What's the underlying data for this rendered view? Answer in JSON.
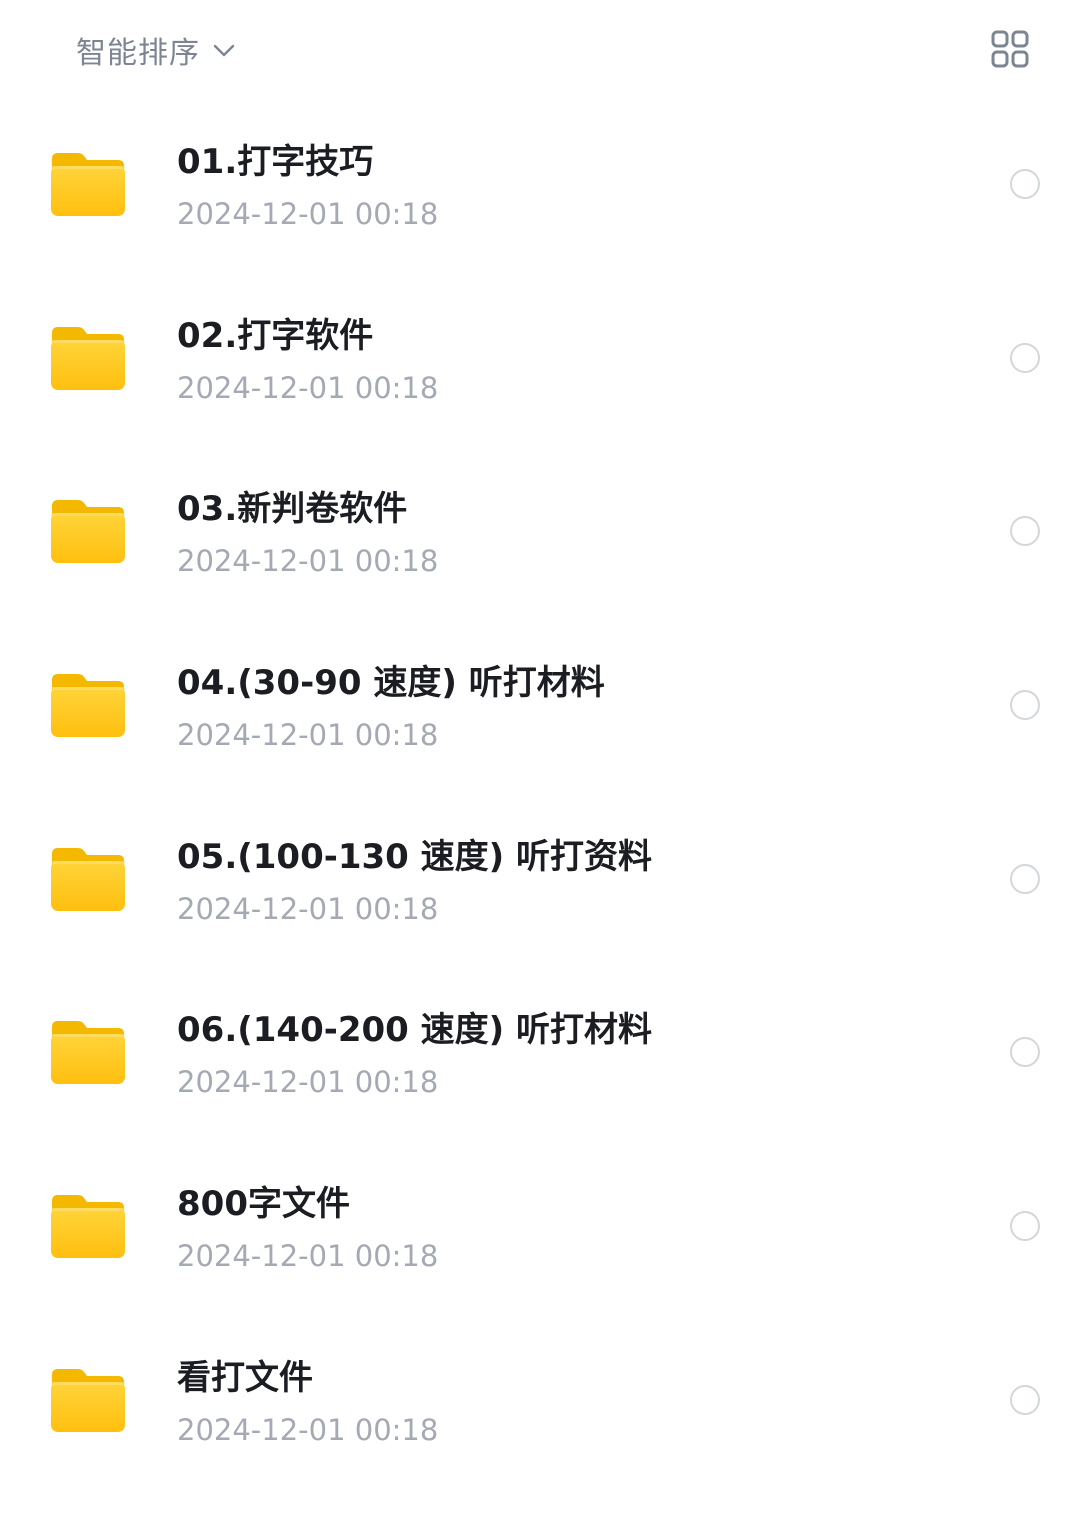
{
  "toolbar": {
    "sort_label": "智能排序",
    "sort_icon": "chevron-down-icon",
    "view_toggle_icon": "grid-view-icon"
  },
  "colors": {
    "folder": "#ffc81a",
    "folder_tab": "#f5b800",
    "checkbox_border": "#d3d6db",
    "date_text": "#a4a9b3",
    "sort_text": "#7d8593"
  },
  "files": [
    {
      "name": "01.打字技巧",
      "date": "2024-12-01 00:18",
      "icon": "folder-icon"
    },
    {
      "name": "02.打字软件",
      "date": "2024-12-01 00:18",
      "icon": "folder-icon"
    },
    {
      "name": "03.新判卷软件",
      "date": "2024-12-01 00:18",
      "icon": "folder-icon"
    },
    {
      "name": "04.(30-90 速度) 听打材料",
      "date": "2024-12-01 00:18",
      "icon": "folder-icon"
    },
    {
      "name": "05.(100-130 速度) 听打资料",
      "date": "2024-12-01 00:18",
      "icon": "folder-icon"
    },
    {
      "name": "06.(140-200 速度) 听打材料",
      "date": "2024-12-01 00:18",
      "icon": "folder-icon"
    },
    {
      "name": "800字文件",
      "date": "2024-12-01 00:18",
      "icon": "folder-icon"
    },
    {
      "name": "看打文件",
      "date": "2024-12-01 00:18",
      "icon": "folder-icon"
    }
  ]
}
